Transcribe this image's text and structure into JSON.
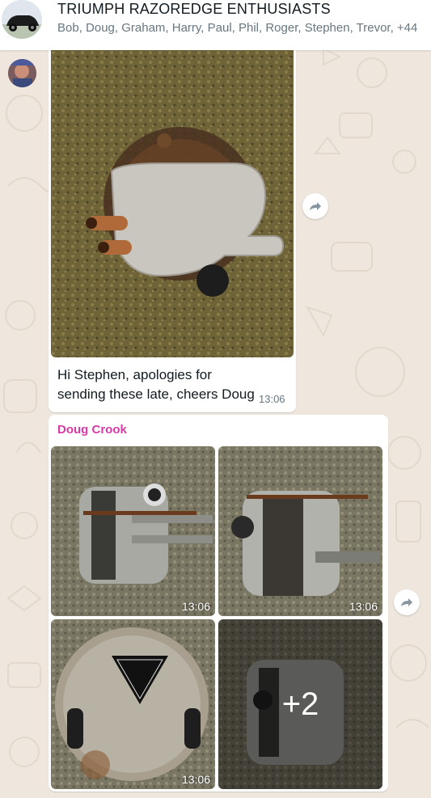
{
  "header": {
    "title": "TRIUMPH RAZOREDGE ENTHUSIASTS",
    "members": "Bob, Doug, Graham, Harry, Paul, Phil, Roger, Stephen, Trevor, +44"
  },
  "messages": [
    {
      "caption": "Hi Stephen, apologies for sending these late, cheers Doug",
      "time": "13:06"
    },
    {
      "sender": "Doug Crook",
      "photos": [
        {
          "time": "13:06"
        },
        {
          "time": "13:06"
        },
        {
          "time": "13:06"
        },
        {
          "more": "+2"
        }
      ]
    }
  ],
  "colors": {
    "sender_name": "#d63aa6",
    "wallpaper": "#efe7de"
  }
}
